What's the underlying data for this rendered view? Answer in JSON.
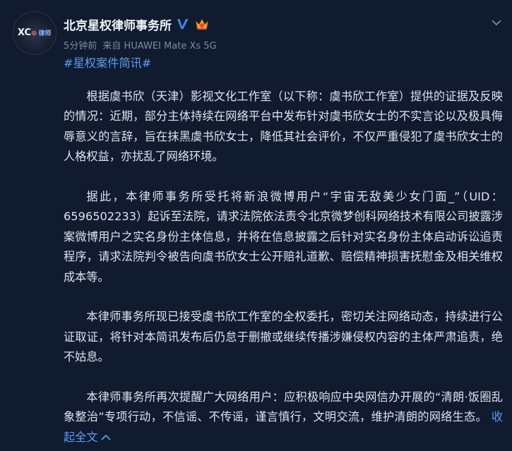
{
  "account": {
    "avatar_text_main": "XC",
    "avatar_text_mid": "⊕",
    "avatar_text_sub": "律师",
    "name": "北京星权律师事务所",
    "time": "5分钟前",
    "source": "来自 HUAWEI Mate Xs 5G"
  },
  "post": {
    "hashtag": "#星权案件简讯#",
    "paragraphs": [
      "根据虞书欣（天津）影视文化工作室（以下称：虞书欣工作室）提供的证据及反映的情况：近期，部分主体持续在网络平台中发布针对虞书欣女士的不实言论以及极具侮辱意义的言辞，旨在抹黑虞书欣女士，降低其社会评价，不仅严重侵犯了虞书欣女士的人格权益，亦扰乱了网络环境。",
      "据此，本律师事务所受托将新浪微博用户“宇宙无敌美少女门面_”（UID：6596502233）起诉至法院，请求法院依法责令北京微梦创科网络技术有限公司披露涉案微博用户之实名身份主体信息，并将在信息披露之后针对实名身份主体启动诉讼追责程序，请求法院判令被告向虞书欣女士公开赔礼道歉、赔偿精神损害抚慰金及相关维权成本等。",
      "本律师事务所现已接受虞书欣工作室的全权委托，密切关注网络动态，持续进行公证取证，将针对本简讯发布后仍怠于删撤或继续传播涉嫌侵权内容的主体严肃追责，绝不姑息。",
      "本律师事务所再次提醒广大网络用户：应积极响应中央网信办开展的“清朗·饭圈乱象整治”专项行动，不信谣、不传谣，谨言慎行，文明交流，维护清朗的网络生态。"
    ],
    "collapse_label": "收起全文"
  },
  "colors": {
    "background": "#101b2f",
    "link": "#5b9cf5",
    "text": "#dde3ee",
    "meta": "#7e8aa1",
    "verified": "#3d8cf0",
    "badge": "#f5a623"
  },
  "icons": {
    "verified": "verified-v-icon",
    "badge": "crown-badge-icon",
    "more": "chevron-down-icon",
    "collapse": "chevron-up-icon"
  }
}
